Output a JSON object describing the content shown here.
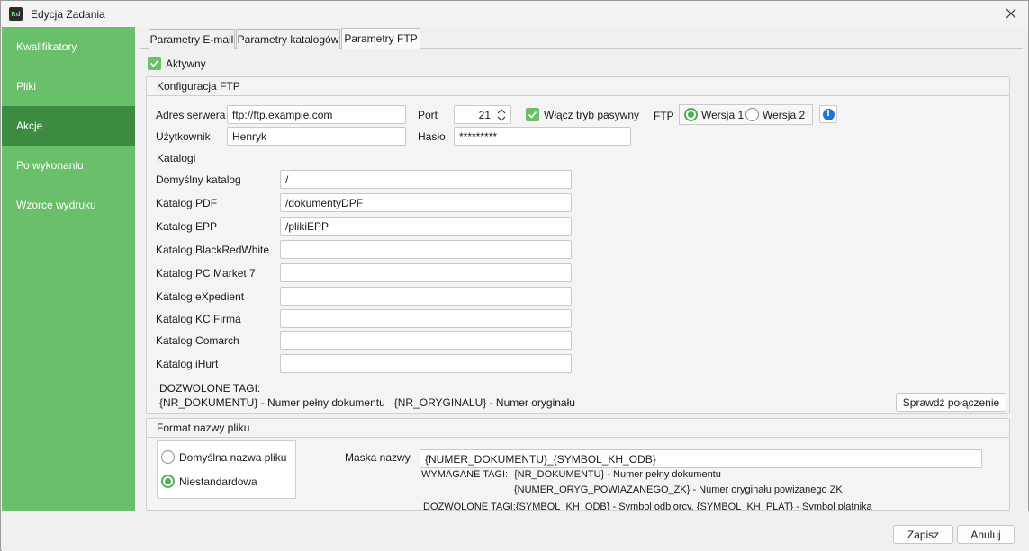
{
  "window": {
    "title": "Edycja Zadania",
    "app_icon_text": "Rd"
  },
  "sidebar": {
    "items": [
      {
        "label": "Kwalifikatory"
      },
      {
        "label": "Pliki"
      },
      {
        "label": "Akcje"
      },
      {
        "label": "Po wykonaniu"
      },
      {
        "label": "Wzorce wydruku"
      }
    ],
    "active_index": 2
  },
  "tabs": [
    {
      "label": "Parametry E-mail"
    },
    {
      "label": "Parametry katalogów"
    },
    {
      "label": "Parametry FTP"
    }
  ],
  "active_tab": "Parametry FTP",
  "active_checkbox": {
    "label": "Aktywny",
    "checked": true
  },
  "ftp_config": {
    "title": "Konfiguracja FTP",
    "server_label": "Adres serwera",
    "server_value": "ftp://ftp.example.com",
    "user_label": "Użytkownik",
    "user_value": "Henryk",
    "port_label": "Port",
    "port_value": "21",
    "password_label": "Hasło",
    "password_value": "*********",
    "passive_label": "Włącz tryb pasywny",
    "passive_checked": true,
    "ftp_label": "FTP",
    "version1_label": "Wersja 1",
    "version2_label": "Wersja 2",
    "selected_version": "Wersja 1",
    "catalogs_header": "Katalogi",
    "catalogs": [
      {
        "label": "Domyślny katalog",
        "value": "/"
      },
      {
        "label": "Katalog PDF",
        "value": "/dokumentyDPF"
      },
      {
        "label": "Katalog EPP",
        "value": "/plikiEPP"
      },
      {
        "label": "Katalog BlackRedWhite",
        "value": ""
      },
      {
        "label": "Katalog PC Market 7",
        "value": ""
      },
      {
        "label": "Katalog eXpedient",
        "value": ""
      },
      {
        "label": "Katalog KC Firma",
        "value": ""
      },
      {
        "label": "Katalog Comarch",
        "value": ""
      },
      {
        "label": "Katalog iHurt",
        "value": ""
      }
    ],
    "allowed_tags_title": "DOZWOLONE TAGI:",
    "allowed_tags_line": "{NR_DOKUMENTU} - Numer pełny dokumentu   {NR_ORYGINALU} - Numer oryginału",
    "test_button": "Sprawdź połączenie"
  },
  "file_name_format": {
    "title": "Format nazwy pliku",
    "option_default": "Domyślna nazwa pliku",
    "option_custom": "Niestandardowa",
    "selected": "Niestandardowa",
    "mask_label": "Maska nazwy",
    "mask_value": "{NUMER_DOKUMENTU}_{SYMBOL_KH_ODB}",
    "required_tags_label": "WYMAGANE TAGI:",
    "required_tag1": "{NR_DOKUMENTU} - Numer pełny dokumentu",
    "required_tag2": "{NUMER_ORYG_POWIAZANEGO_ZK} - Numer oryginału powizanego ZK",
    "allowed_tags_line": "DOZWOLONE TAGI:{SYMBOL_KH_ODB} - Symbol odbiorcy, {SYMBOL_KH_PLAT} - Symbol płatnika"
  },
  "footer": {
    "save_label": "Zapisz",
    "cancel_label": "Anuluj"
  },
  "colors": {
    "accent": "#6abf6a",
    "active_sidebar": "#3d8b40",
    "info": "#1976d2"
  }
}
